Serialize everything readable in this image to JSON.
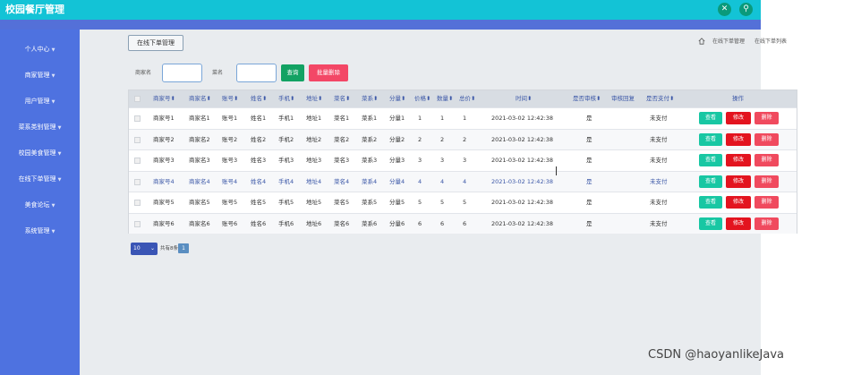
{
  "app": {
    "title": "校园餐厅管理"
  },
  "topbar": {
    "icon_left": "fullscreen-icon",
    "icon_right": "user-icon"
  },
  "sidebar": {
    "items": [
      {
        "label": "个人中心"
      },
      {
        "label": "商家管理"
      },
      {
        "label": "用户管理"
      },
      {
        "label": "菜系类别管理"
      },
      {
        "label": "校园美食管理"
      },
      {
        "label": "在线下单管理"
      },
      {
        "label": "美食论坛"
      },
      {
        "label": "系统管理"
      }
    ]
  },
  "page": {
    "tab_label": "在线下单管理",
    "breadcrumb": [
      "在线下单管理",
      "在线下单列表"
    ]
  },
  "search": {
    "merchant_label": "商家名",
    "merchant_value": "",
    "dish_label": "菜名",
    "dish_value": "",
    "search_button": "查询",
    "bulk_delete_button": "批量删除"
  },
  "table": {
    "columns": [
      "商家号",
      "商家名",
      "账号",
      "姓名",
      "手机",
      "地址",
      "菜名",
      "菜系",
      "分量",
      "价格",
      "数量",
      "总价",
      "时间",
      "是否审核",
      "审核回复",
      "是否支付",
      "操作"
    ],
    "rows": [
      [
        "商家号1",
        "商家名1",
        "账号1",
        "姓名1",
        "手机1",
        "地址1",
        "菜名1",
        "菜系1",
        "分量1",
        "1",
        "1",
        "1",
        "2021-03-02 12:42:38",
        "是",
        "",
        "未支付"
      ],
      [
        "商家号2",
        "商家名2",
        "账号2",
        "姓名2",
        "手机2",
        "地址2",
        "菜名2",
        "菜系2",
        "分量2",
        "2",
        "2",
        "2",
        "2021-03-02 12:42:38",
        "是",
        "",
        "未支付"
      ],
      [
        "商家号3",
        "商家名3",
        "账号3",
        "姓名3",
        "手机3",
        "地址3",
        "菜名3",
        "菜系3",
        "分量3",
        "3",
        "3",
        "3",
        "2021-03-02 12:42:38",
        "是",
        "",
        "未支付"
      ],
      [
        "商家号4",
        "商家名4",
        "账号4",
        "姓名4",
        "手机4",
        "地址4",
        "菜名4",
        "菜系4",
        "分量4",
        "4",
        "4",
        "4",
        "2021-03-02 12:42:38",
        "是",
        "",
        "未支付"
      ],
      [
        "商家号5",
        "商家名5",
        "账号5",
        "姓名5",
        "手机5",
        "地址5",
        "菜名5",
        "菜系5",
        "分量5",
        "5",
        "5",
        "5",
        "2021-03-02 12:42:38",
        "是",
        "",
        "未支付"
      ],
      [
        "商家号6",
        "商家名6",
        "账号6",
        "姓名6",
        "手机6",
        "地址6",
        "菜名6",
        "菜系6",
        "分量6",
        "6",
        "6",
        "6",
        "2021-03-02 12:42:38",
        "是",
        "",
        "未支付"
      ]
    ],
    "actions": {
      "view": "查看",
      "edit": "修改",
      "delete": "删除"
    },
    "highlight_row": 3
  },
  "pager": {
    "page_size": "10",
    "total_text": "共有8条",
    "current_page": "1"
  },
  "watermark": "CSDN @haoyanlikeJava",
  "colors": {
    "accent": "#13c3d6",
    "sidebar": "#4e72e0",
    "view": "#18c7a3",
    "edit": "#e3141f",
    "delete": "#f04a5e",
    "link": "#3b57a7"
  }
}
